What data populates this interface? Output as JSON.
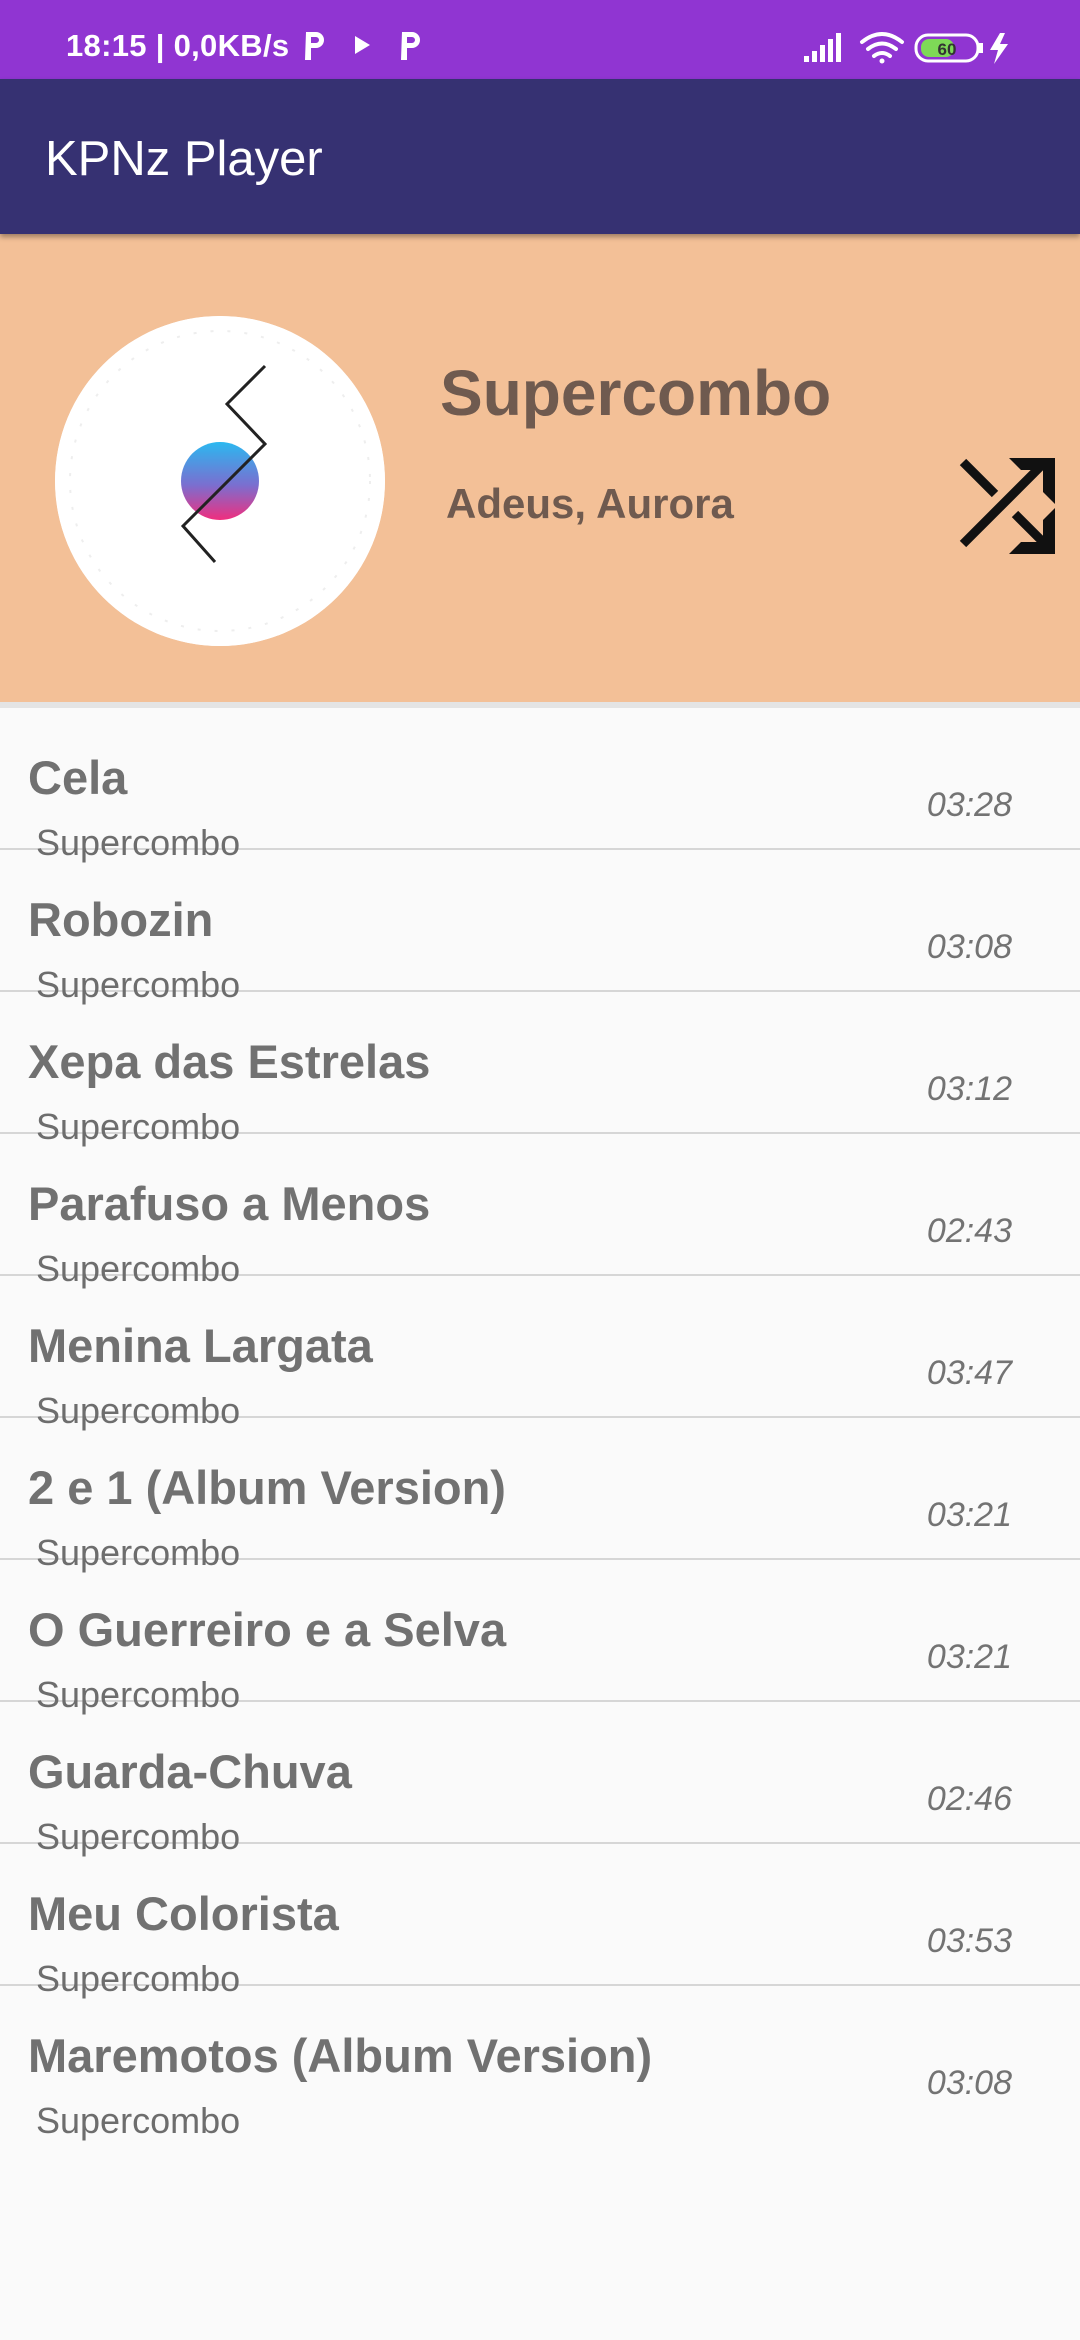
{
  "status_bar": {
    "time_speed": "18:15 | 0,0KB/s",
    "battery": "60"
  },
  "app_bar": {
    "title": "KPNz Player"
  },
  "now_playing": {
    "artist": "Supercombo",
    "album": "Adeus, Aurora"
  },
  "colors": {
    "status_bar": "#9035d2",
    "app_bar": "#363172",
    "header_bg": "#f3c097",
    "list_bg": "#fafafa"
  },
  "tracks": [
    {
      "title": "Cela",
      "artist": "Supercombo",
      "duration": "03:28"
    },
    {
      "title": "Robozin",
      "artist": "Supercombo",
      "duration": "03:08"
    },
    {
      "title": "Xepa das Estrelas",
      "artist": "Supercombo",
      "duration": "03:12"
    },
    {
      "title": "Parafuso a Menos",
      "artist": "Supercombo",
      "duration": "02:43"
    },
    {
      "title": "Menina Largata",
      "artist": "Supercombo",
      "duration": "03:47"
    },
    {
      "title": "2 e 1 (Album Version)",
      "artist": "Supercombo",
      "duration": "03:21"
    },
    {
      "title": "O Guerreiro e a Selva",
      "artist": "Supercombo",
      "duration": "03:21"
    },
    {
      "title": "Guarda-Chuva",
      "artist": "Supercombo",
      "duration": "02:46"
    },
    {
      "title": "Meu Colorista",
      "artist": "Supercombo",
      "duration": "03:53"
    },
    {
      "title": "Maremotos (Album Version)",
      "artist": "Supercombo",
      "duration": "03:08"
    }
  ]
}
